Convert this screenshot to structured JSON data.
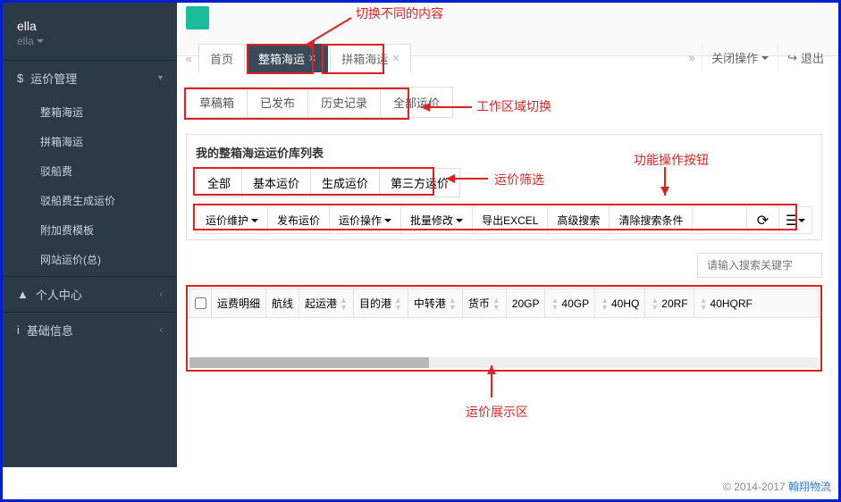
{
  "sidebar": {
    "user": "ella",
    "user_sub": "ella",
    "groups": [
      {
        "icon": "dollar",
        "label": "运价管理",
        "chev": "down",
        "items": [
          "整箱海运",
          "拼箱海运",
          "驳船费",
          "驳船费生成运价",
          "附加费模板",
          "网站运价(总)"
        ]
      },
      {
        "icon": "person",
        "label": "个人中心",
        "chev": "left"
      },
      {
        "icon": "info",
        "label": "基础信息",
        "chev": "left"
      }
    ]
  },
  "top": {
    "tab_home": "首页",
    "tab_active": "整箱海运",
    "tab_other": "拼箱海运",
    "close_ops": "关闭操作",
    "logout": "退出"
  },
  "ws_tabs": [
    "草稿箱",
    "已发布",
    "历史记录",
    "全部运价"
  ],
  "panel_title": "我的整箱海运运价库列表",
  "filters": [
    "全部",
    "基本运价",
    "生成运价",
    "第三方运价"
  ],
  "actions": [
    "运价维护",
    "发布运价",
    "运价操作",
    "批量修改",
    "导出EXCEL",
    "高级搜索",
    "清除搜索条件"
  ],
  "action_has_caret": [
    true,
    false,
    true,
    true,
    false,
    false,
    false
  ],
  "search_placeholder": "请输入搜索关键字",
  "columns": [
    "运费明细",
    "航线",
    "起运港",
    "目的港",
    "中转港",
    "货币",
    "20GP",
    "40GP",
    "40HQ",
    "20RF",
    "40HQRF"
  ],
  "col_sortable": [
    false,
    false,
    true,
    true,
    true,
    true,
    false,
    true,
    true,
    true,
    true
  ],
  "annotations": {
    "a1": "切换不同的内容",
    "a2": "工作区域切换",
    "a3": "运价筛选",
    "a4": "功能操作按钮",
    "a5": "运价展示区"
  },
  "footer_year": "© 2014-2017 ",
  "footer_link": "翰翔物流"
}
